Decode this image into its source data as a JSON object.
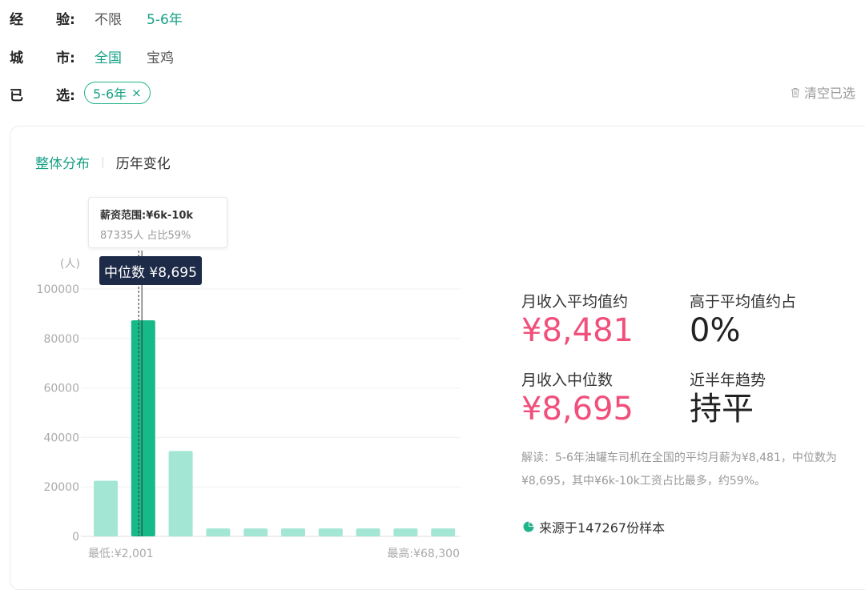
{
  "filters": {
    "experience": {
      "label_1": "经",
      "label_2": "验:",
      "options": [
        "不限",
        "5-6年"
      ],
      "selected_index": 1
    },
    "city": {
      "label_1": "城",
      "label_2": "市:",
      "options": [
        "全国",
        "宝鸡"
      ],
      "selected_index": 0
    },
    "selected": {
      "label_1": "已",
      "label_2": "选:",
      "chip": "5-6年",
      "chip_remove": "×"
    },
    "clear_all": "清空已选"
  },
  "tabs": [
    {
      "label": "整体分布",
      "active": true
    },
    {
      "label": "历年变化",
      "active": false
    }
  ],
  "tooltip": {
    "title": "薪资范围:¥6k-10k",
    "detail": "87335人  占比59%"
  },
  "median_badge": "中位数 ¥8,695",
  "stats": {
    "avg_label": "月收入平均值约",
    "avg_value": "¥8,481",
    "above_label": "高于平均值约占",
    "above_value": "0%",
    "median_label": "月收入中位数",
    "median_value": "¥8,695",
    "trend_label": "近半年趋势",
    "trend_value": "持平"
  },
  "interpretation": "解读：5-6年油罐车司机在全国的平均月薪为¥8,481，中位数为¥8,695，其中¥6k-10k工资占比最多，约59%。",
  "source": "来源于147267份样本",
  "colors": {
    "accent": "#16a085",
    "bar_light": "#a3e6d4",
    "bar_active": "#18b988",
    "stat_pink": "#f0507b",
    "badge_bg": "#1e2b48"
  },
  "chart_data": {
    "type": "bar",
    "ylabel": "(人)",
    "yticks": [
      "0",
      "20000",
      "40000",
      "60000",
      "80000",
      "100000"
    ],
    "ylim": [
      0,
      100000
    ],
    "values": [
      22500,
      87335,
      34500,
      3200,
      3200,
      3200,
      3200,
      3200,
      3200,
      3200
    ],
    "highlight_index": 1,
    "median_position": 1.2,
    "x_min_label": "最低:¥2,001",
    "x_max_label": "最高:¥68,300",
    "grid": true
  }
}
